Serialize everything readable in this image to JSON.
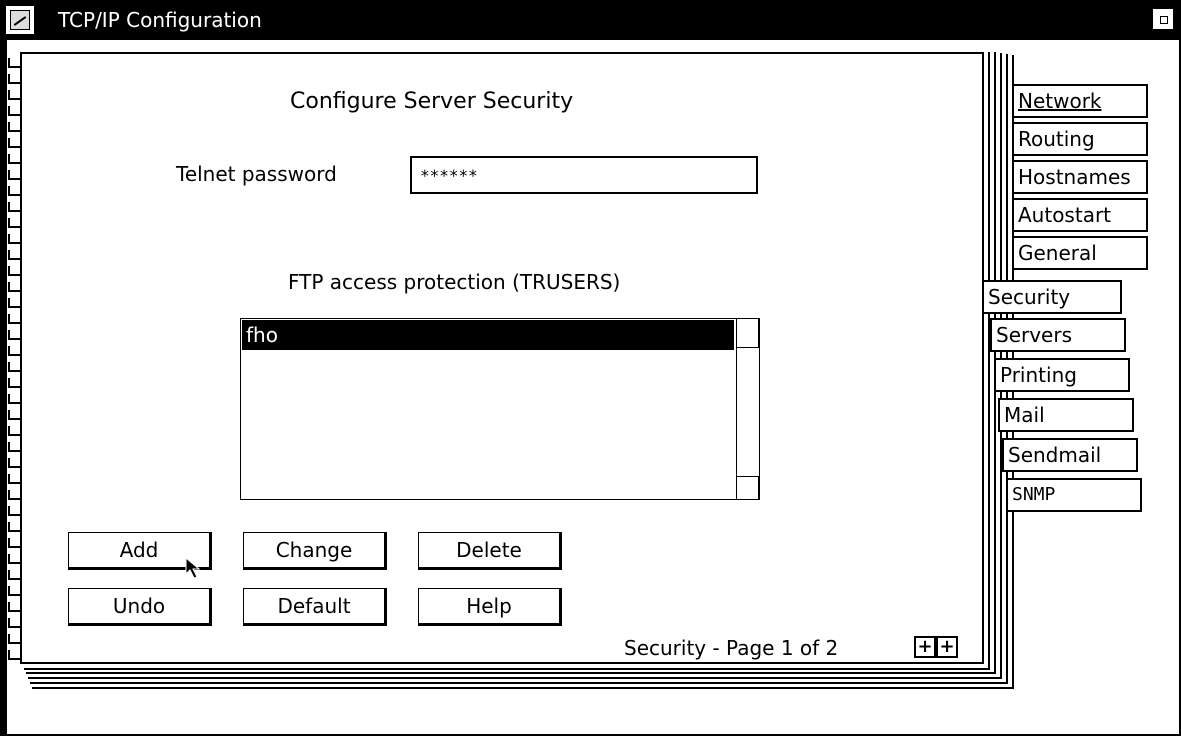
{
  "window": {
    "title": "TCP/IP Configuration"
  },
  "page": {
    "heading": "Configure   Server   Security",
    "telnet_label": "Telnet password",
    "telnet_value": "******",
    "ftp_label": "FTP access protection (TRUSERS)",
    "list_items": [
      "fho"
    ],
    "selected_item": "fho",
    "page_info": "Security - Page 1 of 2"
  },
  "buttons": {
    "add": "Add",
    "change": "Change",
    "delete": "Delete",
    "undo": "Undo",
    "default": "Default",
    "help": "Help"
  },
  "tabs": {
    "network": "Network",
    "routing": "Routing",
    "hostnames": "Hostnames",
    "autostart": "Autostart",
    "general": "General",
    "security": "Security",
    "servers": "Servers",
    "printing": "Printing",
    "mail": "Mail",
    "sendmail": "Sendmail",
    "snmp": "SNMP"
  },
  "icons": {
    "system_menu": "system-menu-icon",
    "maximize": "maximize-icon",
    "prev_page": "arrow-left-icon",
    "next_page": "arrow-right-icon",
    "mouse_cursor": "mouse-pointer-icon"
  },
  "colors": {
    "titlebar": "#000000",
    "selection": "#000000",
    "background": "#ffffff"
  }
}
